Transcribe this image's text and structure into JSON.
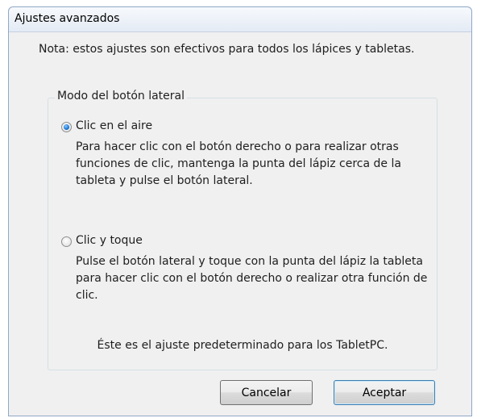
{
  "window": {
    "title": "Ajustes avanzados"
  },
  "note": "Nota: estos ajustes son efectivos para todos los lápices y tabletas.",
  "group": {
    "legend": "Modo del botón lateral",
    "options": [
      {
        "label": "Clic en el aire",
        "description": "Para hacer clic con el botón derecho o para realizar otras funciones de clic, mantenga la punta del lápiz cerca de la tableta y pulse el botón lateral.",
        "selected": true
      },
      {
        "label": "Clic y toque",
        "description": "Pulse el botón lateral y toque con la punta del lápiz la tableta para hacer clic con el botón derecho o realizar otra función de clic.",
        "selected": false
      }
    ],
    "default_note": "Éste es el ajuste predeterminado para los TabletPC."
  },
  "buttons": {
    "cancel": "Cancelar",
    "ok": "Aceptar"
  }
}
